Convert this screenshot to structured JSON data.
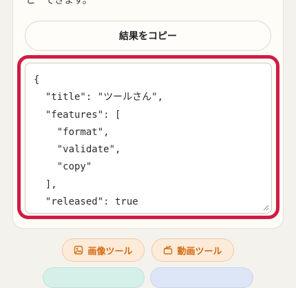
{
  "helper_text": "ピーできます。",
  "copy_button": {
    "label": "結果をコピー"
  },
  "textarea": {
    "value": "{\n  \"title\": \"ツールさん\",\n  \"features\": [\n    \"format\",\n    \"validate\",\n    \"copy\"\n  ],\n  \"released\": true\n}"
  },
  "tool_links": [
    {
      "label": "画像ツール",
      "icon": "image-icon"
    },
    {
      "label": "動画ツール",
      "icon": "clapperboard-icon"
    }
  ],
  "colors": {
    "focus_ring": "#d01c45",
    "pill_text": "#d46a10",
    "pill_bg": "#fcebd8"
  }
}
